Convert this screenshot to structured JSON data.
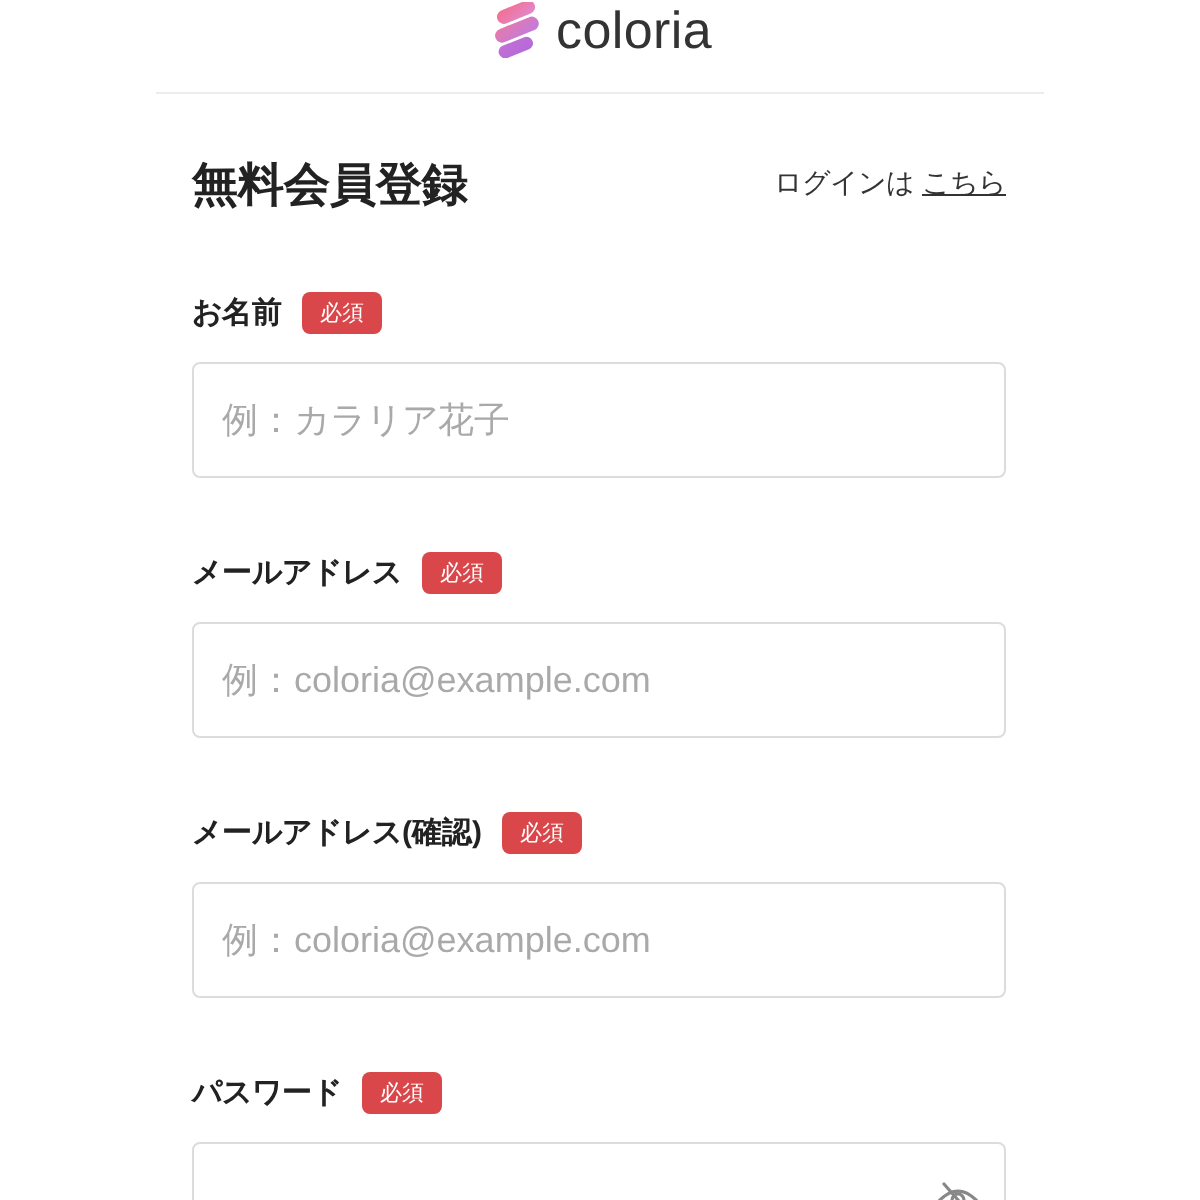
{
  "header": {
    "logo_text": "coloria"
  },
  "form": {
    "title": "無料会員登録",
    "login_prompt": "ログインは",
    "login_link": "こちら",
    "fields": [
      {
        "kind": "text",
        "label": "お名前",
        "badge": "必須",
        "placeholder": "例：カラリア花子"
      },
      {
        "kind": "email",
        "label": "メールアドレス",
        "badge": "必須",
        "placeholder": "例：coloria@example.com"
      },
      {
        "kind": "email",
        "label": "メールアドレス(確認)",
        "badge": "必須",
        "placeholder": "例：coloria@example.com"
      },
      {
        "kind": "password",
        "label": "パスワード",
        "badge": "必須"
      }
    ]
  }
}
